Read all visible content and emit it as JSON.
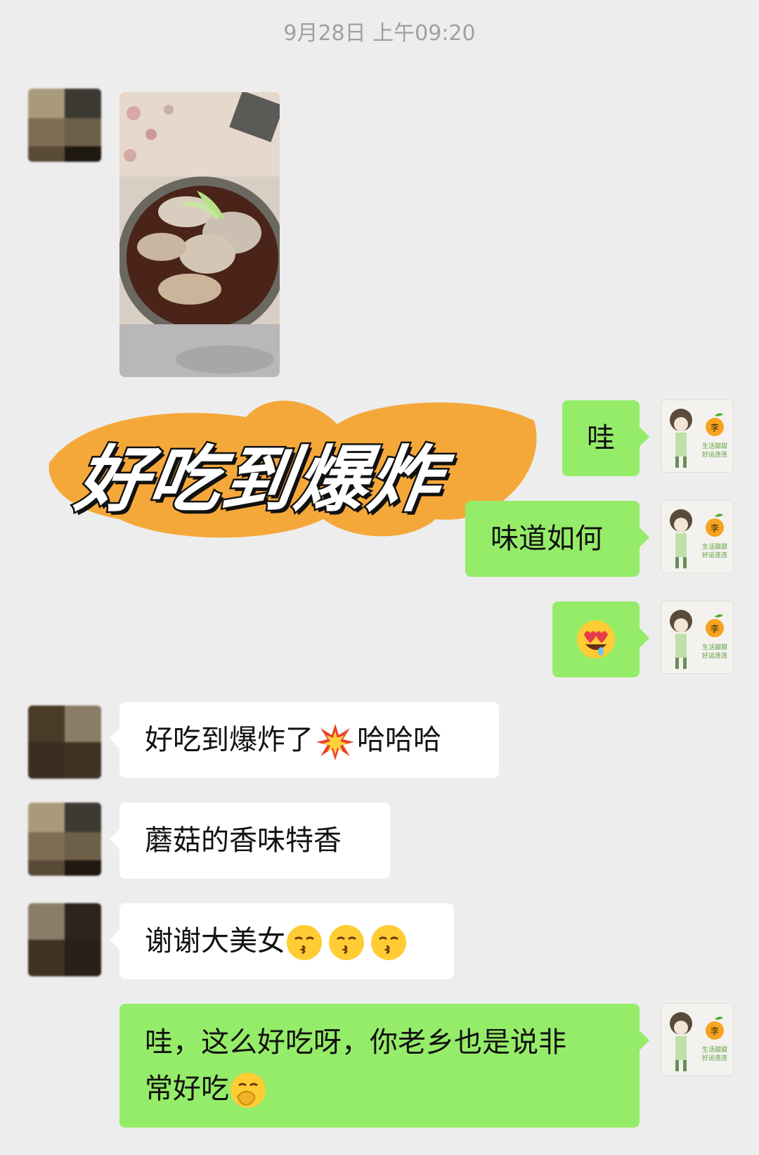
{
  "chat": {
    "timestamp": "9月28日 上午09:20",
    "sticker_text": "好吃到爆炸",
    "messages": {
      "m1": "哇",
      "m2": "味道如何",
      "m4_a": "好吃到爆炸了",
      "m4_b": "哈哈哈",
      "m5": "蘑菇的香味特香",
      "m6": "谢谢大美女",
      "m7_line1": "哇，这么好吃呀，你老乡也是说非",
      "m7_line2": "常好吃"
    },
    "my_avatar": {
      "badge_char": "李",
      "caption_line1": "生活甜甜",
      "caption_line2": "好运连连"
    }
  },
  "colors": {
    "background": "#ededed",
    "incoming_bubble": "#ffffff",
    "outgoing_bubble": "#95ec69",
    "sticker_brush": "#f5a83a"
  },
  "icons": {
    "heart_eyes": "heart-eyes-emoji",
    "explosion": "collision-emoji",
    "kiss": "kissing-face-emoji",
    "hand_over_mouth": "face-with-hand-over-mouth-emoji"
  }
}
